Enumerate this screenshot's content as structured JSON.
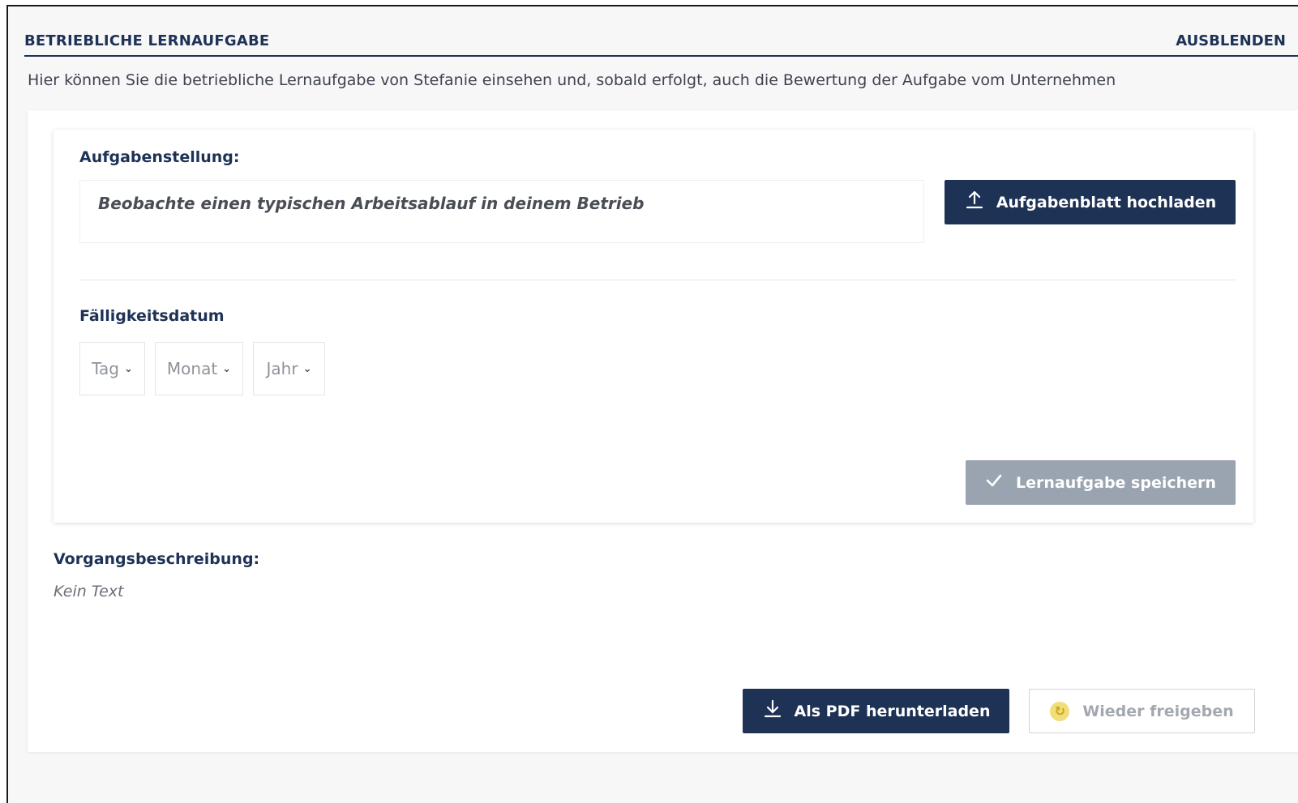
{
  "section": {
    "title": "BETRIEBLICHE LERNAUFGABE",
    "hide_label": "AUSBLENDEN",
    "intro": "Hier können Sie die betriebliche Lernaufgabe von Stefanie einsehen und, sobald erfolgt, auch die Bewertung der Aufgabe vom Unternehmen"
  },
  "task": {
    "label": "Aufgabenstellung:",
    "text": "Beobachte einen  typischen Arbeitsablauf in  deinem Betrieb",
    "upload_label": "Aufgabenblatt hochladen",
    "upload_icon": "upload-icon"
  },
  "due_date": {
    "label": "Fälligkeitsdatum",
    "day_placeholder": "Tag",
    "month_placeholder": "Monat",
    "year_placeholder": "Jahr",
    "chevron_icon": "chevron-down-icon"
  },
  "save": {
    "label": "Lernaufgabe speichern",
    "icon": "check-icon",
    "color": "#9aa3b0"
  },
  "process": {
    "label": "Vorgangsbeschreibung:",
    "text": "Kein Text"
  },
  "actions": {
    "pdf_label": "Als PDF herunterladen",
    "pdf_icon": "download-icon",
    "release_label": "Wieder freigeben",
    "release_icon": "sync-icon"
  },
  "colors": {
    "primary": "#1e3256",
    "disabled": "#9aa3b0",
    "accent_icon": "#f1dd7a"
  }
}
